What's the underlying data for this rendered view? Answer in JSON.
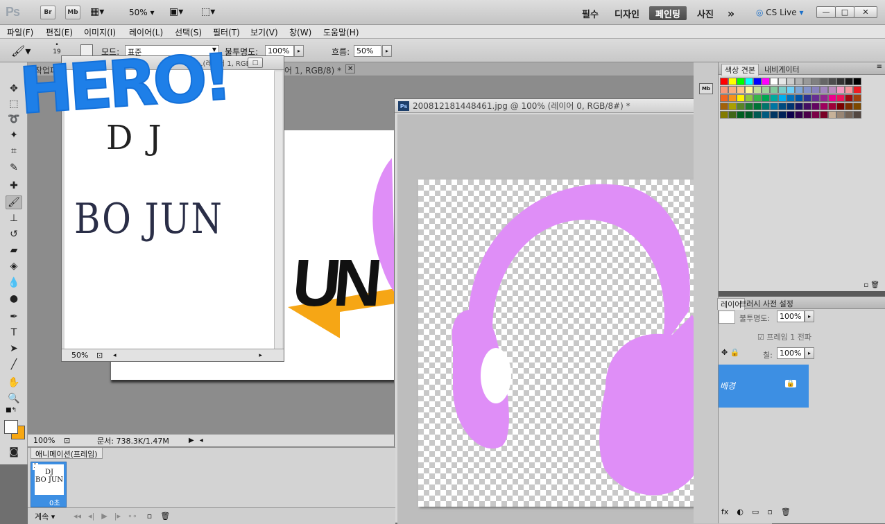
{
  "appbar": {
    "logo": "Ps",
    "bridge_btn": "Br",
    "minibridge_btn": "Mb",
    "zoom": "50%",
    "workspaces": [
      "필수",
      "디자인",
      "페인팅",
      "사진"
    ],
    "active_workspace": "페인팅",
    "more": "»",
    "cslive": "CS Live",
    "window_min": "—",
    "window_max": "□",
    "window_close": "✕"
  },
  "menubar": {
    "items": [
      "파일(F)",
      "편집(E)",
      "이미지(I)",
      "레이어(L)",
      "선택(S)",
      "필터(T)",
      "보기(V)",
      "창(W)",
      "도움말(H)"
    ]
  },
  "options": {
    "brush_size": "19",
    "mode_label": "모드:",
    "mode_value": "표준",
    "opacity_label": "불투명도:",
    "opacity_value": "100%",
    "flow_label": "흐름:",
    "flow_value": "50%"
  },
  "tabrow": {
    "tab_left": "작업파",
    "tab_mid": "어 1, RGB/8) *"
  },
  "hero_window": {
    "title": "...(레이어 1, RGB/8)",
    "hero_text": "HERO!",
    "dj_text": "DJ",
    "name_text": "BO JUN",
    "zoom": "50%"
  },
  "back_document": {
    "zoom": "100%",
    "doc_info": "문서: 738.3K/1.47M",
    "fragment_text": "UN"
  },
  "headphones_window": {
    "title": "200812181448461.jpg @ 100% (레이어 0, RGB/8#) *",
    "ps_icon": "Ps",
    "graphic_color": "#df8ef7"
  },
  "swatches_panel": {
    "tabs": [
      "색상 견본",
      "내비게이터"
    ],
    "active_tab": "색상 견본"
  },
  "layers_panel": {
    "tabs": [
      "레이어",
      "브러시 사전 설정"
    ],
    "opacity_label": "불투명도:",
    "opacity_value": "100%",
    "propagate_label": "프레임 1 전파",
    "fill_label": "칠:",
    "fill_value": "100%",
    "layer_name": "배경"
  },
  "animation_panel": {
    "title": "애니메이션(프레임)",
    "frame_number": "1",
    "frame_delay": "0초",
    "loop_label": "계속"
  },
  "colors": {
    "foreground": "#ffffff",
    "background": "#f7a712",
    "hero_blue": "#1e7fe8",
    "layer_highlight": "#3d8fe3",
    "arrow_orange": "#f6a615"
  }
}
